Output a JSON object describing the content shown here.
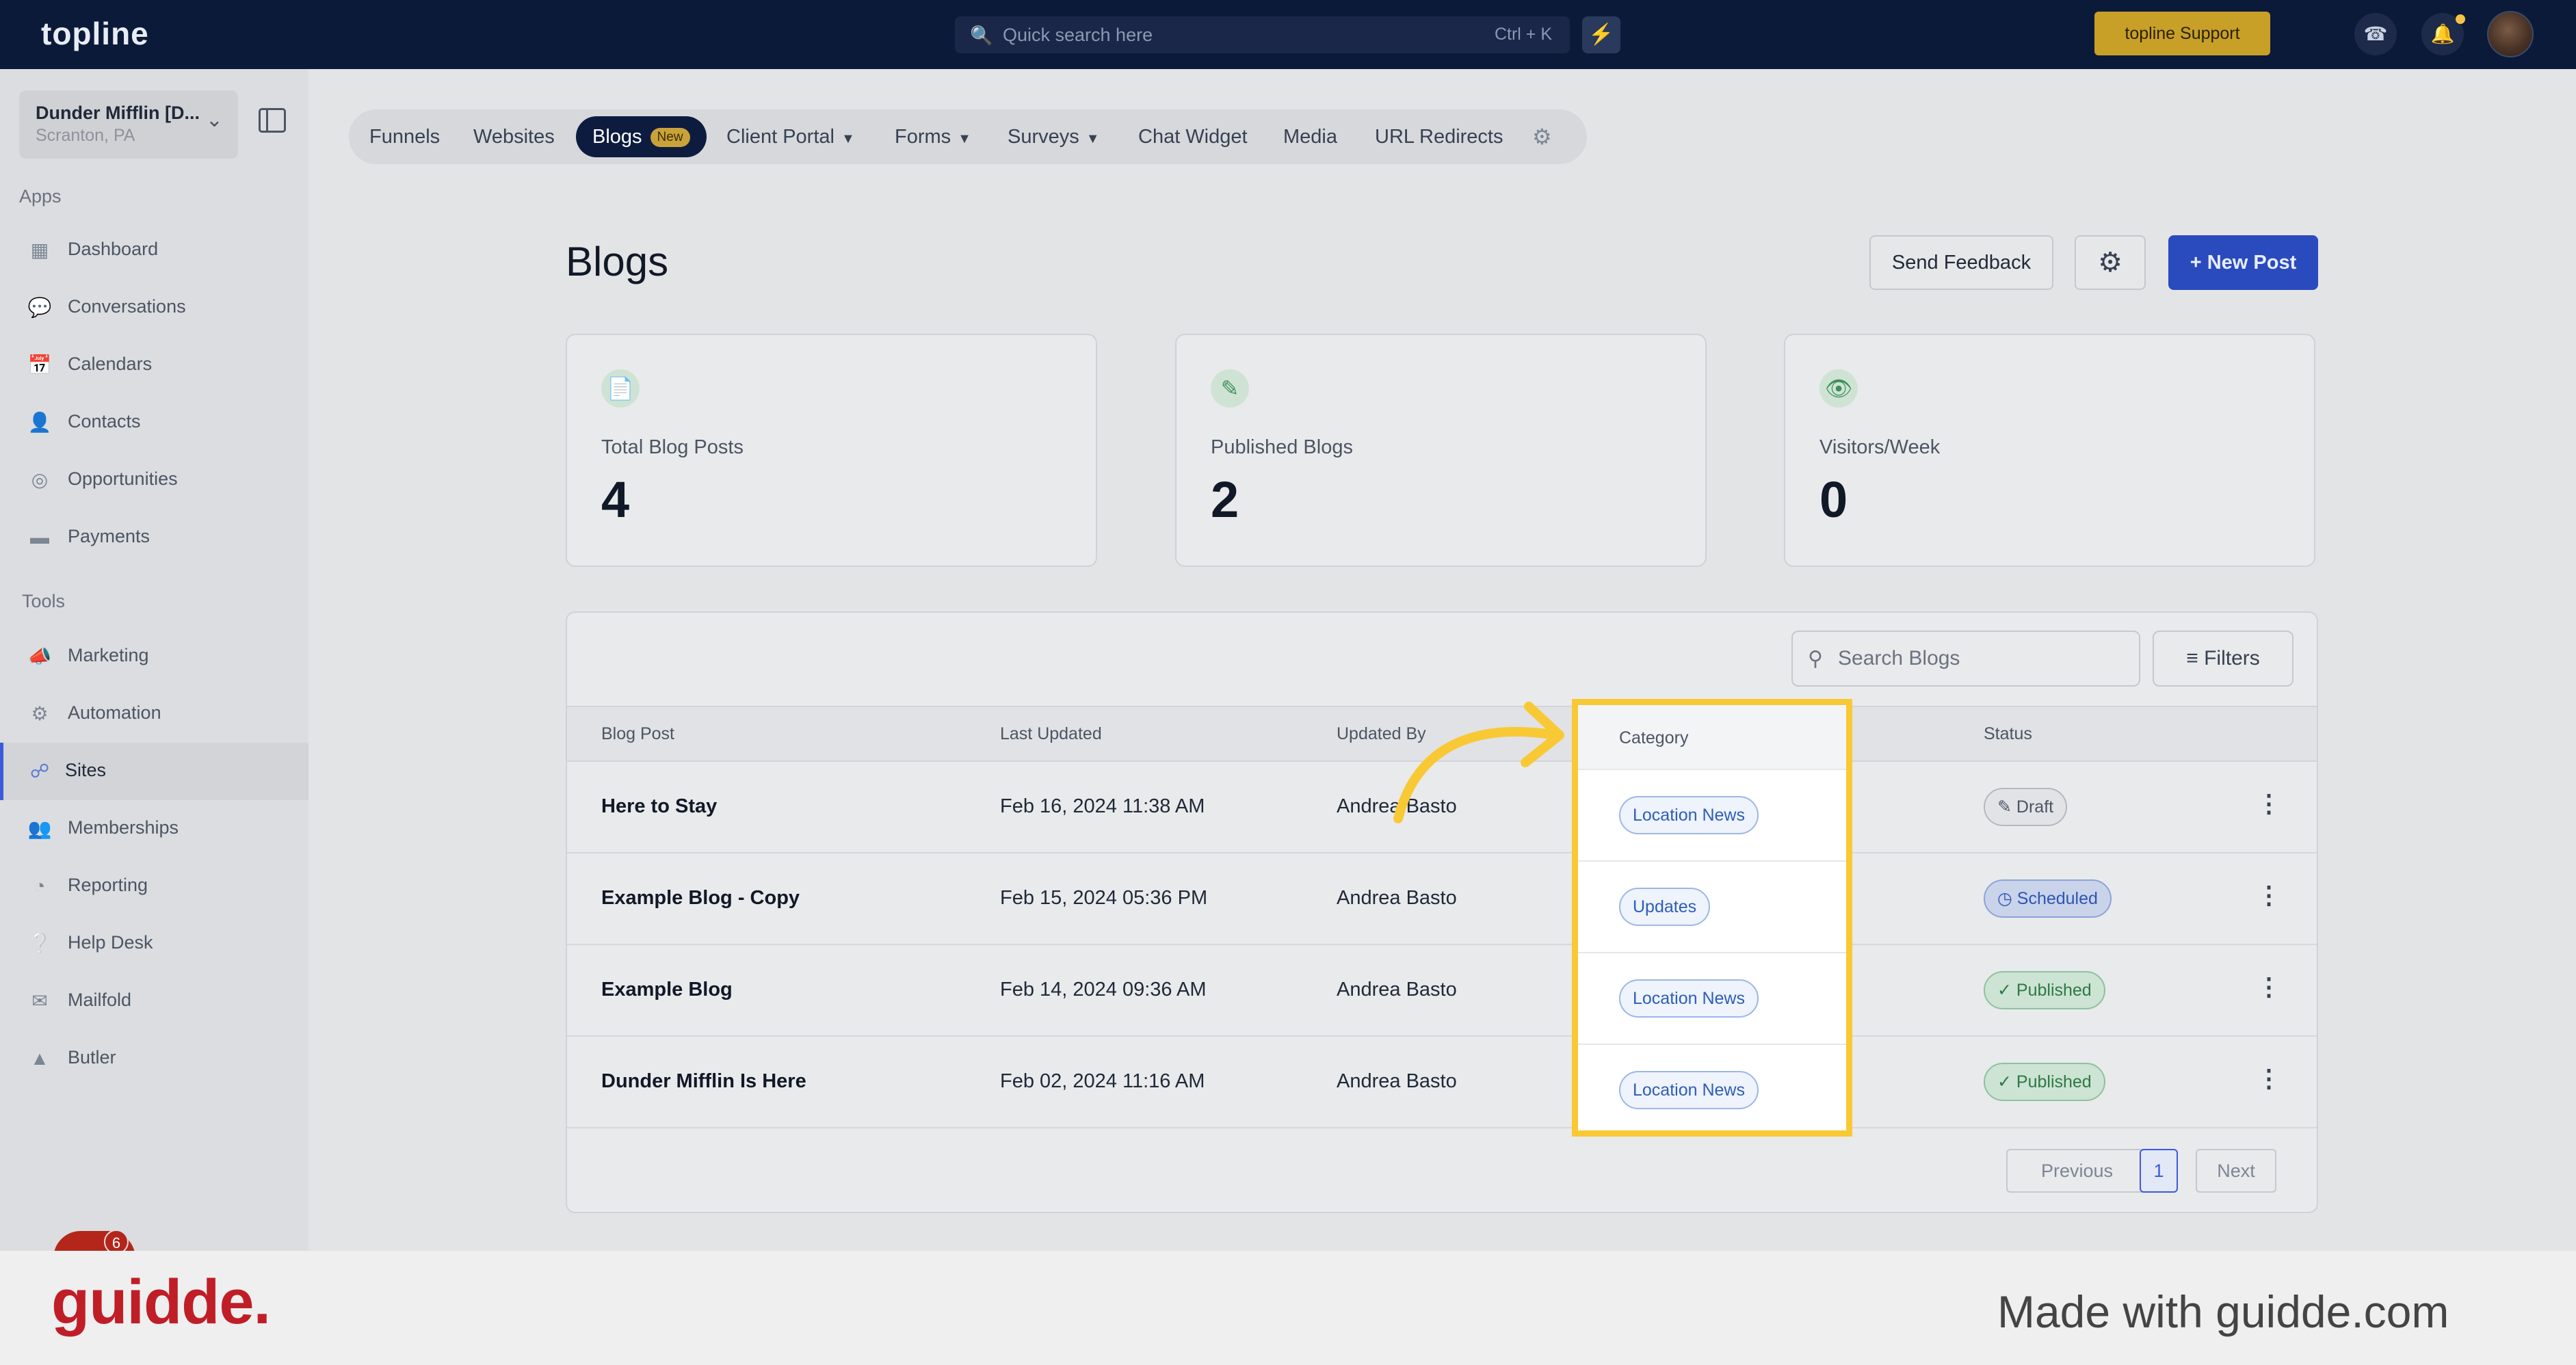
{
  "topbar": {
    "logo": "topline",
    "search_placeholder": "Quick search here",
    "search_shortcut": "Ctrl + K",
    "support_label": "topline Support"
  },
  "sidebar": {
    "location_name": "Dunder Mifflin [D...",
    "location_sub": "Scranton, PA",
    "apps_heading": "Apps",
    "apps": [
      {
        "label": "Dashboard",
        "icon": "dashboard-icon"
      },
      {
        "label": "Conversations",
        "icon": "chat-icon"
      },
      {
        "label": "Calendars",
        "icon": "calendar-icon"
      },
      {
        "label": "Contacts",
        "icon": "contact-icon"
      },
      {
        "label": "Opportunities",
        "icon": "target-icon"
      },
      {
        "label": "Payments",
        "icon": "card-icon"
      }
    ],
    "tools_heading": "Tools",
    "tools": [
      {
        "label": "Marketing",
        "icon": "megaphone-icon"
      },
      {
        "label": "Automation",
        "icon": "gears-icon"
      },
      {
        "label": "Sites",
        "icon": "globe-icon",
        "active": true
      },
      {
        "label": "Memberships",
        "icon": "members-icon"
      },
      {
        "label": "Reporting",
        "icon": "pie-icon"
      },
      {
        "label": "Help Desk",
        "icon": "help-icon"
      },
      {
        "label": "Mailfold",
        "icon": "mail-icon"
      },
      {
        "label": "Butler",
        "icon": "bell-icon"
      }
    ],
    "chat_badge_count": "6"
  },
  "tabs": [
    {
      "label": "Funnels"
    },
    {
      "label": "Websites"
    },
    {
      "label": "Blogs",
      "badge": "New",
      "active": true
    },
    {
      "label": "Client Portal",
      "dropdown": true
    },
    {
      "label": "Forms",
      "dropdown": true
    },
    {
      "label": "Surveys",
      "dropdown": true
    },
    {
      "label": "Chat Widget"
    },
    {
      "label": "Media"
    },
    {
      "label": "URL Redirects"
    }
  ],
  "page": {
    "title": "Blogs",
    "send_feedback": "Send Feedback",
    "new_post": "+ New Post"
  },
  "stats": [
    {
      "label": "Total Blog Posts",
      "value": "4",
      "icon": "document-icon"
    },
    {
      "label": "Published Blogs",
      "value": "2",
      "icon": "image-edit-icon"
    },
    {
      "label": "Visitors/Week",
      "value": "0",
      "icon": "eye-icon"
    }
  ],
  "table": {
    "search_placeholder": "Search Blogs",
    "filters_label": "Filters",
    "columns": {
      "post": "Blog Post",
      "updated": "Last Updated",
      "by": "Updated By",
      "category": "Category",
      "status": "Status"
    },
    "rows": [
      {
        "title": "Here to Stay",
        "updated": "Feb 16, 2024 11:38 AM",
        "by": "Andrea Basto",
        "category": "Location News",
        "status": "Draft"
      },
      {
        "title": "Example Blog - Copy",
        "updated": "Feb 15, 2024 05:36 PM",
        "by": "Andrea Basto",
        "category": "Updates",
        "status": "Scheduled"
      },
      {
        "title": "Example Blog",
        "updated": "Feb 14, 2024 09:36 AM",
        "by": "Andrea Basto",
        "category": "Location News",
        "status": "Published"
      },
      {
        "title": "Dunder Mifflin Is Here",
        "updated": "Feb 02, 2024 11:16 AM",
        "by": "Andrea Basto",
        "category": "Location News",
        "status": "Published"
      }
    ],
    "pagination": {
      "previous": "Previous",
      "page": "1",
      "next": "Next"
    }
  },
  "footer": {
    "brand": "guidde.",
    "made_with": "Made with guidde.com"
  },
  "colors": {
    "highlight": "#f8c934",
    "primary": "#2a4bbd",
    "topbar": "#0c1a3a",
    "brand_red": "#c01e27"
  }
}
